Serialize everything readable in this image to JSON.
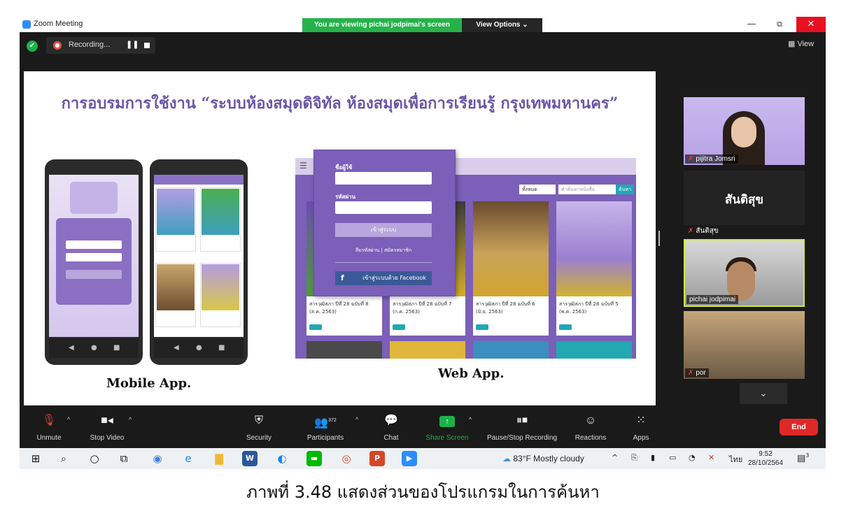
{
  "window": {
    "app_title": "Zoom Meeting",
    "viewing_banner": "You are viewing pichai jodpimai's screen",
    "view_options": "View Options ⌄",
    "minimize": "—",
    "restore": "⧉",
    "close": "✕"
  },
  "top_toolbar": {
    "recording_label": "Recording...",
    "pause": "❚❚",
    "view_label": "View",
    "view_icon": "grid-icon"
  },
  "slide": {
    "title": "การอบรมการใช้งาน “ระบบห้องสมุดดิจิทัล ห้องสมุดเพื่อการเรียนรู้ กรุงเทพมหานคร”",
    "mobile_label": "Mobile App.",
    "web_label": "Web App.",
    "login": {
      "username_label": "ชื่อผู้ใช้",
      "password_label": "รหัสผ่าน",
      "submit": "เข้าสู่ระบบ",
      "links": "ลืมรหัสผ่าน | สมัครสมาชิก",
      "facebook": "เข้าสู่ระบบด้วย Facebook"
    },
    "web": {
      "filter": "ทั้งหมด",
      "search_placeholder": "คำค้นหาหนังสือ",
      "search_button": "ค้นหา",
      "books": [
        {
          "caption": "สารวุฒิสภา ปีที่ 28 ฉบับที่ 8 (ส.ค. 2563)"
        },
        {
          "caption": "สารวุฒิสภา ปีที่ 28 ฉบับที่ 7 (ก.ค. 2563)"
        },
        {
          "caption": "สารวุฒิสภา ปีที่ 28 ฉบับที่ 6 (มิ.ย. 2563)"
        },
        {
          "caption": "สารวุฒิสภา ปีที่ 28 ฉบับที่ 5 (พ.ค. 2563)"
        }
      ]
    }
  },
  "participants": {
    "tile1_name": "pijitra Jomsri",
    "tile2_big": "สันติสุข",
    "tile2_name": "สันติสุข",
    "tile3_name": "pichai jodpimai",
    "tile4_name": "por"
  },
  "bottom_toolbar": {
    "unmute": "Unmute",
    "stop_video": "Stop Video",
    "security": "Security",
    "participants": "Participants",
    "participants_count": "372",
    "chat": "Chat",
    "share_screen": "Share Screen",
    "pause_recording": "Pause/Stop Recording",
    "reactions": "Reactions",
    "apps": "Apps",
    "end": "End"
  },
  "taskbar": {
    "weather": "83°F  Mostly cloudy",
    "language": "ไทย",
    "time": "9:52",
    "date": "28/10/2564",
    "notifications": "3"
  },
  "caption": "ภาพที่  3.48 แสดงส่วนของโปรแกรมในการค้นหา",
  "colors": {
    "zoom_bg": "#1a1a1a",
    "banner_green": "#26b24a",
    "brand_purple": "#7b5fb8",
    "end_red": "#e02828",
    "active_speaker": "#d0e64a"
  }
}
